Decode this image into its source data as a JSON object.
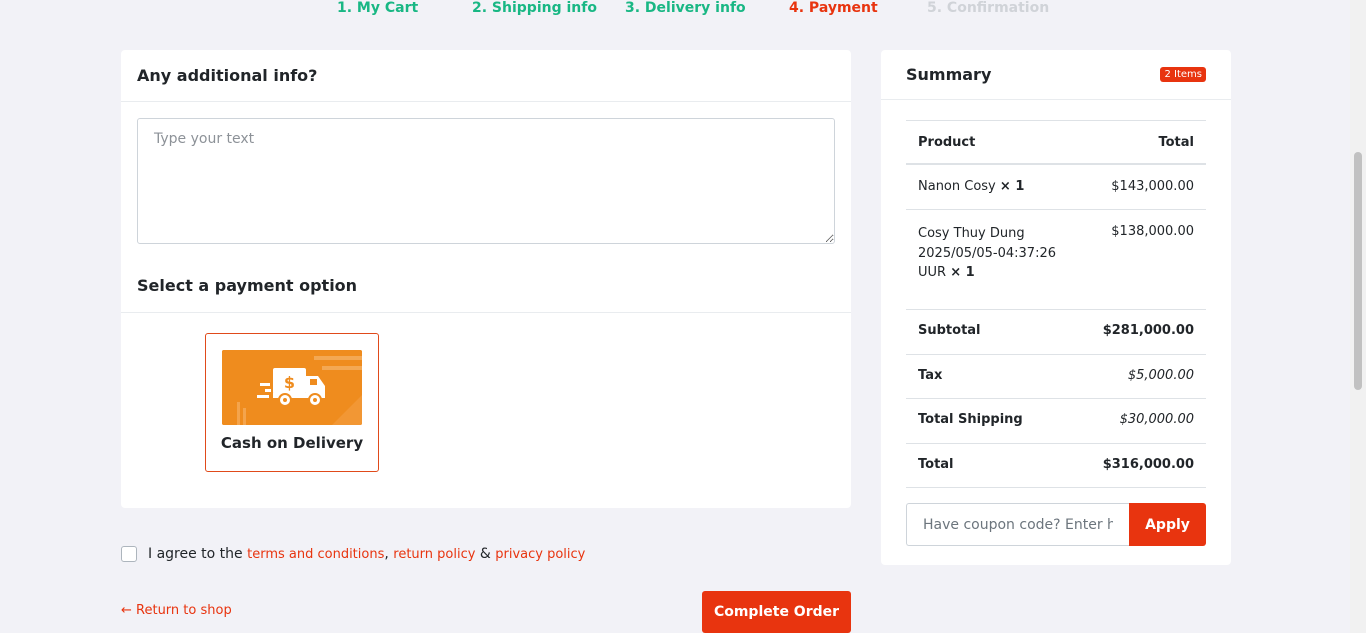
{
  "steps": [
    {
      "label": "1. My Cart",
      "state": "done"
    },
    {
      "label": "2. Shipping info",
      "state": "done"
    },
    {
      "label": "3. Delivery info",
      "state": "done"
    },
    {
      "label": "4. Payment",
      "state": "active"
    },
    {
      "label": "5. Confirmation",
      "state": "todo"
    }
  ],
  "additional": {
    "title": "Any additional info?",
    "placeholder": "Type your text"
  },
  "payment": {
    "title": "Select a payment option",
    "option_label": "Cash on Delivery",
    "option_icon": "delivery-truck-dollar-icon"
  },
  "agreement": {
    "prefix": "I agree to the",
    "terms": "terms and conditions",
    "sep1": ",",
    "return_policy": "return policy",
    "amp": "&",
    "privacy": "privacy policy"
  },
  "return_link": "← Return to shop",
  "complete_label": "Complete Order",
  "summary": {
    "title": "Summary",
    "badge": "2 Items",
    "head_product": "Product",
    "head_total": "Total",
    "items": [
      {
        "name": "Nanon Cosy",
        "qty": "× 1",
        "price": "$143,000.00"
      },
      {
        "name": "Cosy Thuy Dung 2025/05/05-04:37:26 UUR",
        "qty": "× 1",
        "price": "$138,000.00"
      }
    ],
    "subtotal_label": "Subtotal",
    "subtotal": "$281,000.00",
    "tax_label": "Tax",
    "tax": "$5,000.00",
    "shipping_label": "Total Shipping",
    "shipping": "$30,000.00",
    "total_label": "Total",
    "total": "$316,000.00",
    "coupon_placeholder": "Have coupon code? Enter here",
    "apply_label": "Apply"
  },
  "colors": {
    "accent": "#e8340f",
    "done": "#19b784",
    "todo": "#d0d3d8",
    "cod_bg": "#ef8c1e"
  }
}
